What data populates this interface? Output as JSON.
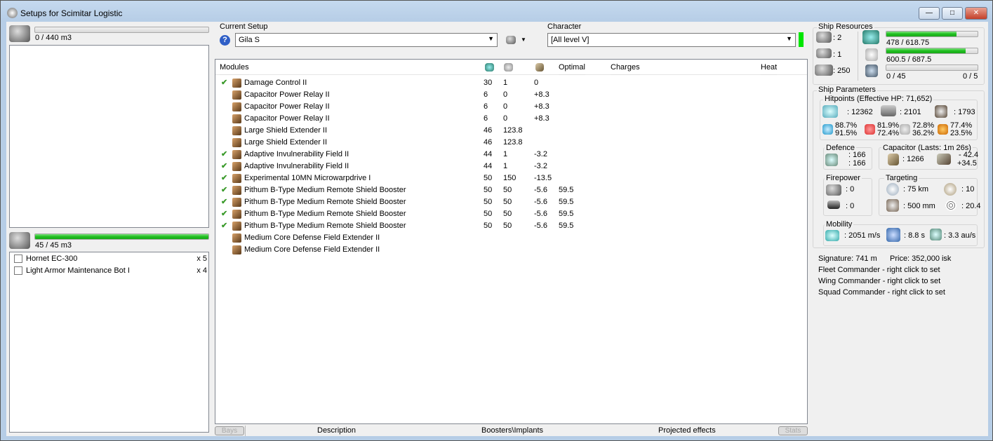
{
  "window": {
    "title": "Setups for Scimitar Logistic",
    "min": "—",
    "max": "□",
    "close": "✕"
  },
  "cargo": {
    "text": "0 / 440 m3",
    "fill": 0
  },
  "drones": {
    "text": "45 / 45 m3",
    "fill": 1.0,
    "items": [
      {
        "name": "Hornet EC-300",
        "qty": "x 5"
      },
      {
        "name": "Light Armor Maintenance Bot I",
        "qty": "x 4"
      }
    ]
  },
  "setup": {
    "label": "Current Setup",
    "value": "Gila S",
    "help": "?"
  },
  "character": {
    "label": "Character",
    "value": "[All level V]"
  },
  "modules": {
    "headers": [
      "Modules",
      "",
      "",
      "",
      "Optimal",
      "Charges",
      "Heat"
    ],
    "rows": [
      {
        "on": true,
        "name": "Damage Control II",
        "cpu": "30",
        "pg": "1",
        "cap": "0",
        "opt": ""
      },
      {
        "on": false,
        "name": "Capacitor Power Relay II",
        "cpu": "6",
        "pg": "0",
        "cap": "+8.3",
        "opt": ""
      },
      {
        "on": false,
        "name": "Capacitor Power Relay II",
        "cpu": "6",
        "pg": "0",
        "cap": "+8.3",
        "opt": ""
      },
      {
        "on": false,
        "name": "Capacitor Power Relay II",
        "cpu": "6",
        "pg": "0",
        "cap": "+8.3",
        "opt": ""
      },
      {
        "on": false,
        "name": "Large Shield Extender II",
        "cpu": "46",
        "pg": "123.8",
        "cap": "",
        "opt": ""
      },
      {
        "on": false,
        "name": "Large Shield Extender II",
        "cpu": "46",
        "pg": "123.8",
        "cap": "",
        "opt": ""
      },
      {
        "on": true,
        "name": "Adaptive Invulnerability Field II",
        "cpu": "44",
        "pg": "1",
        "cap": "-3.2",
        "opt": ""
      },
      {
        "on": true,
        "name": "Adaptive Invulnerability Field II",
        "cpu": "44",
        "pg": "1",
        "cap": "-3.2",
        "opt": ""
      },
      {
        "on": true,
        "name": "Experimental 10MN Microwarpdrive I",
        "cpu": "50",
        "pg": "150",
        "cap": "-13.5",
        "opt": ""
      },
      {
        "on": true,
        "name": "Pithum B-Type Medium Remote Shield Booster",
        "cpu": "50",
        "pg": "50",
        "cap": "-5.6",
        "opt": "59.5"
      },
      {
        "on": true,
        "name": "Pithum B-Type Medium Remote Shield Booster",
        "cpu": "50",
        "pg": "50",
        "cap": "-5.6",
        "opt": "59.5"
      },
      {
        "on": true,
        "name": "Pithum B-Type Medium Remote Shield Booster",
        "cpu": "50",
        "pg": "50",
        "cap": "-5.6",
        "opt": "59.5"
      },
      {
        "on": true,
        "name": "Pithum B-Type Medium Remote Shield Booster",
        "cpu": "50",
        "pg": "50",
        "cap": "-5.6",
        "opt": "59.5"
      },
      {
        "on": false,
        "name": "Medium Core Defense Field Extender II",
        "cpu": "",
        "pg": "",
        "cap": "",
        "opt": ""
      },
      {
        "on": false,
        "name": "Medium Core Defense Field Extender II",
        "cpu": "",
        "pg": "",
        "cap": "",
        "opt": ""
      }
    ]
  },
  "tabs": {
    "bays": "Bays",
    "description": "Description",
    "boosters": "Boosters\\Implants",
    "projected": "Projected effects",
    "stats": "Stats"
  },
  "resources": {
    "label": "Ship Resources",
    "turrets": ": 2",
    "launchers": ": 1",
    "calibration": ": 250",
    "cpu": {
      "text": "478 / 618.75",
      "fill": 0.773
    },
    "pg": {
      "text": "600.5 / 687.5",
      "fill": 0.873
    },
    "drone_bw": {
      "text": "0 / 45",
      "fill": 0
    },
    "drones_active": "0 / 5"
  },
  "params": {
    "label": "Ship Parameters",
    "hp_label": "Hitpoints (Effective HP: 71,652)",
    "shield": ": 12362",
    "armor": ": 2101",
    "hull": ": 1793",
    "resists": [
      [
        "88.7%",
        "91.5%"
      ],
      [
        "81.9%",
        "72.4%"
      ],
      [
        "72.8%",
        "36.2%"
      ],
      [
        "77.4%",
        "23.5%"
      ]
    ],
    "defence_label": "Defence",
    "def1": ": 166",
    "def2": ": 166",
    "cap_label": "Capacitor (Lasts: 1m 26s)",
    "cap": ": 1266",
    "cap_use": "- 42.4",
    "cap_rech": "+34.5",
    "fire_label": "Firepower",
    "fire1": ": 0",
    "fire2": ": 0",
    "tgt_label": "Targeting",
    "range": ": 75 km",
    "targets": ": 10",
    "sensor": ": 500 mm",
    "scan": ": 20.4",
    "mob_label": "Mobility",
    "speed": ": 2051 m/s",
    "align": ": 8.8 s",
    "warp": ": 3.3 au/s",
    "signature": "Signature: 741 m",
    "price": "Price: 352,000 isk",
    "fleet": "Fleet Commander - right click to set",
    "wing": "Wing Commander - right click to set",
    "squad": "Squad Commander - right click to set"
  }
}
